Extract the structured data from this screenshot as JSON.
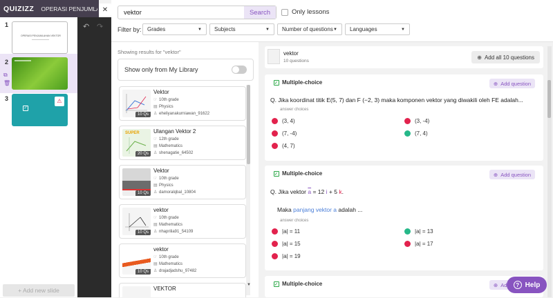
{
  "app": {
    "logo": "QUIZIZZ",
    "title": "OPERASI PENJUMLAH..."
  },
  "slides": {
    "items": [
      {
        "num": "1"
      },
      {
        "num": "2"
      },
      {
        "num": "3"
      }
    ],
    "slide1_title": "OPERASI PENJUMLAHAN VEKTOR",
    "add_label": "+ Add new slide"
  },
  "search": {
    "value": "vektor",
    "button": "Search",
    "only_lessons": "Only lessons"
  },
  "filters": {
    "label": "Filter by:",
    "grades": "Grades",
    "subjects": "Subjects",
    "num_questions": "Number of questions",
    "languages": "Languages"
  },
  "results": {
    "showing": "Showing results for \"vektor\"",
    "library_toggle": "Show only from My Library",
    "cards": [
      {
        "title": "Vektor",
        "grade": "10th grade",
        "subject": "Physics",
        "author": "eheliyanakurniawan_91622",
        "qs": "10 Qs",
        "super": ""
      },
      {
        "title": "Ulangan Vektor 2",
        "grade": "12th grade",
        "subject": "Mathematics",
        "author": "shenagatie_64502",
        "qs": "20 Qs",
        "super": "SUPER"
      },
      {
        "title": "Vektor",
        "grade": "10th grade",
        "subject": "Physics",
        "author": "damoralqbal_10804",
        "qs": "10 Qs",
        "super": ""
      },
      {
        "title": "vektor",
        "grade": "10th grade",
        "subject": "Mathematics",
        "author": "nhaprilia91_54109",
        "qs": "10 Qs",
        "super": ""
      },
      {
        "title": "vektor",
        "grade": "10th grade",
        "subject": "Mathematics",
        "author": "drajadjadshu_97482",
        "qs": "10 Qs",
        "super": ""
      },
      {
        "title": "VEKTOR",
        "grade": "",
        "subject": "",
        "author": "",
        "qs": "",
        "super": ""
      }
    ]
  },
  "preview": {
    "title": "vektor",
    "count": "10 questions",
    "add_all": "Add all 10 questions",
    "questions": [
      {
        "type": "Multiple-choice",
        "add": "Add question",
        "text": "Q. Jika koordinat titik E(5, 7) dan F (−2, 3) maka komponen vektor yang diwakili oleh FE adalah...",
        "answer_label": "answer choices",
        "options": [
          "(3, 4)",
          "(3, -4)",
          "(7, -4)",
          "(7, 4)",
          "(4, 7)"
        ]
      },
      {
        "type": "Multiple-choice",
        "add": "Add question",
        "q_prefix": "Q. Jika vektor",
        "q_a": "a",
        "q_eq": "= 12",
        "q_i": "i",
        "q_plus": "+ 5",
        "q_k": "k",
        "q_end": ".",
        "line2_pre": "Maka",
        "line2_link": "panjang vektor a",
        "line2_post": "adalah ...",
        "answer_label": "answer choices",
        "options": [
          "|a| = 11",
          "|a| = 13",
          "|a| = 15",
          "|a| = 17",
          "|a| = 19"
        ]
      },
      {
        "type": "Multiple-choice",
        "add": "Add question"
      }
    ]
  },
  "help": "Help",
  "colors": {
    "accent": "#8854c0",
    "wrong": "#e2224d",
    "correct": "#26b889"
  }
}
